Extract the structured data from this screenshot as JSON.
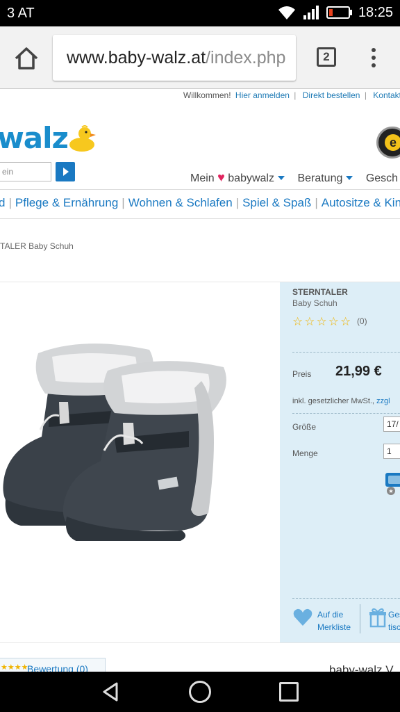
{
  "status": {
    "carrier": "3 AT",
    "time": "18:25"
  },
  "browser": {
    "url_domain": "www.baby-walz.at",
    "url_path": "/index.php",
    "tab_count": "2"
  },
  "header": {
    "welcome": "Willkommen!",
    "login": "Hier anmelden",
    "direct_order": "Direkt bestellen",
    "contact": "Kontakt",
    "logo_text": "walz",
    "search_placeholder": "ein"
  },
  "mainnav": {
    "mein": "Mein",
    "babywalz": "babywalz",
    "beratung": "Beratung",
    "gesch": "Gesch"
  },
  "catnav": [
    "d",
    "Pflege & Ernährung",
    "Wohnen & Schlafen",
    "Spiel & Spaß",
    "Autositze & Kinderwa"
  ],
  "breadcrumb": "TALER Baby Schuh",
  "product": {
    "brand": "STERNTALER",
    "name": "Baby Schuh",
    "stars": "☆☆☆☆☆",
    "rating_count": "(0)",
    "price_label": "Preis",
    "price": "21,99 €",
    "vat_text": "inkl. gesetzlicher MwSt.,",
    "vat_link": "zzgl",
    "size_label": "Größe",
    "size_value": "17/",
    "qty_label": "Menge",
    "qty_value": "1",
    "wishlist_line1": "Auf die",
    "wishlist_line2": "Merkliste",
    "gift_line1": "Ges",
    "gift_line2": "tisc"
  },
  "footer": {
    "review_tab": "Bewertung (0)",
    "bottom_title": "baby-walz V"
  },
  "colors": {
    "brand_blue": "#1a8dcc",
    "link_blue": "#1a79c2",
    "panel_bg": "#ddeef7",
    "star": "#f0b400",
    "heart": "#e0245e"
  }
}
